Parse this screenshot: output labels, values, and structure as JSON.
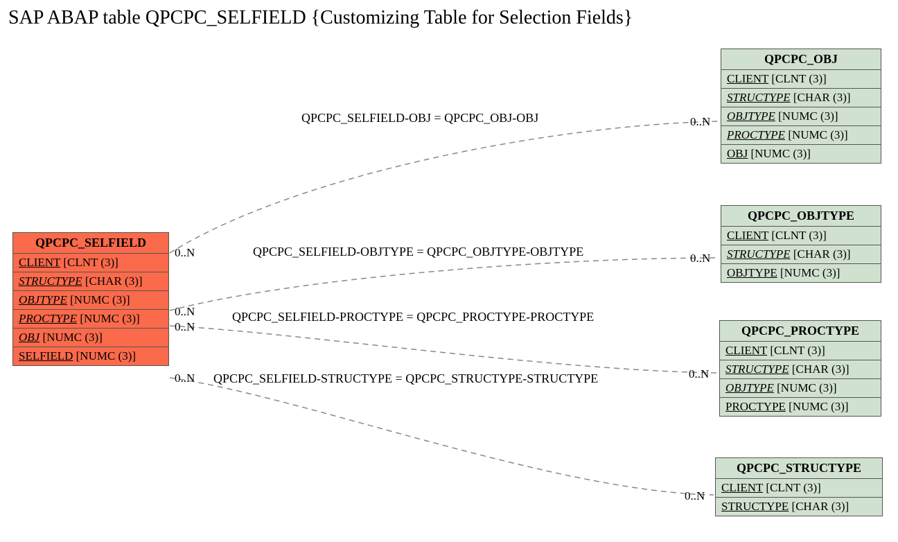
{
  "title": "SAP ABAP table QPCPC_SELFIELD {Customizing Table for Selection Fields}",
  "main": {
    "name": "QPCPC_SELFIELD",
    "fields": [
      {
        "key": "CLIENT",
        "italic": false,
        "type": "CLNT (3)"
      },
      {
        "key": "STRUCTYPE",
        "italic": true,
        "type": "CHAR (3)"
      },
      {
        "key": "OBJTYPE",
        "italic": true,
        "type": "NUMC (3)"
      },
      {
        "key": "PROCTYPE",
        "italic": true,
        "type": "NUMC (3)"
      },
      {
        "key": "OBJ",
        "italic": true,
        "type": "NUMC (3)"
      },
      {
        "key": "SELFIELD",
        "italic": false,
        "type": "NUMC (3)"
      }
    ]
  },
  "refs": [
    {
      "name": "QPCPC_OBJ",
      "fields": [
        {
          "key": "CLIENT",
          "italic": false,
          "type": "CLNT (3)"
        },
        {
          "key": "STRUCTYPE",
          "italic": true,
          "type": "CHAR (3)"
        },
        {
          "key": "OBJTYPE",
          "italic": true,
          "type": "NUMC (3)"
        },
        {
          "key": "PROCTYPE",
          "italic": true,
          "type": "NUMC (3)"
        },
        {
          "key": "OBJ",
          "italic": false,
          "type": "NUMC (3)"
        }
      ]
    },
    {
      "name": "QPCPC_OBJTYPE",
      "fields": [
        {
          "key": "CLIENT",
          "italic": false,
          "type": "CLNT (3)"
        },
        {
          "key": "STRUCTYPE",
          "italic": true,
          "type": "CHAR (3)"
        },
        {
          "key": "OBJTYPE",
          "italic": false,
          "type": "NUMC (3)"
        }
      ]
    },
    {
      "name": "QPCPC_PROCTYPE",
      "fields": [
        {
          "key": "CLIENT",
          "italic": false,
          "type": "CLNT (3)"
        },
        {
          "key": "STRUCTYPE",
          "italic": true,
          "type": "CHAR (3)"
        },
        {
          "key": "OBJTYPE",
          "italic": true,
          "type": "NUMC (3)"
        },
        {
          "key": "PROCTYPE",
          "italic": false,
          "type": "NUMC (3)"
        }
      ]
    },
    {
      "name": "QPCPC_STRUCTYPE",
      "fields": [
        {
          "key": "CLIENT",
          "italic": false,
          "type": "CLNT (3)"
        },
        {
          "key": "STRUCTYPE",
          "italic": false,
          "type": "CHAR (3)"
        }
      ]
    }
  ],
  "rels": [
    {
      "label": "QPCPC_SELFIELD-OBJ = QPCPC_OBJ-OBJ",
      "leftCard": "0..N",
      "rightCard": "0..N"
    },
    {
      "label": "QPCPC_SELFIELD-OBJTYPE = QPCPC_OBJTYPE-OBJTYPE",
      "leftCard": "0..N",
      "rightCard": "0..N"
    },
    {
      "label": "QPCPC_SELFIELD-PROCTYPE = QPCPC_PROCTYPE-PROCTYPE",
      "leftCard": "0..N",
      "rightCard": "0..N"
    },
    {
      "label": "QPCPC_SELFIELD-STRUCTYPE = QPCPC_STRUCTYPE-STRUCTYPE",
      "leftCard": "0..N",
      "rightCard": "0..N"
    }
  ]
}
